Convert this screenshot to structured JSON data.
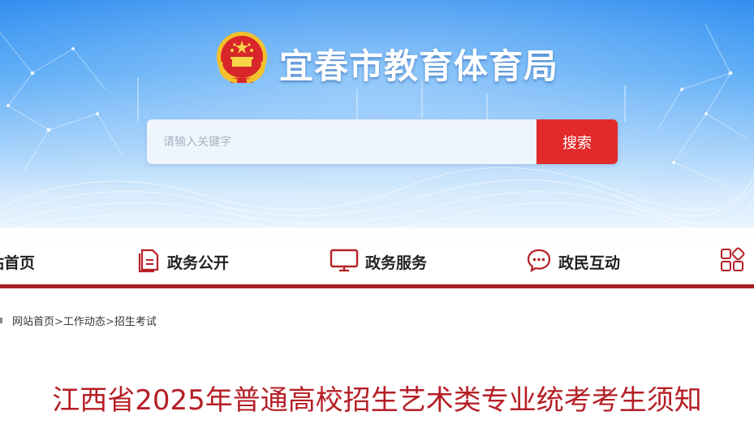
{
  "header": {
    "site_title": "宜春市教育体育局",
    "emblem": "national-emblem"
  },
  "search": {
    "placeholder": "请输入关键字",
    "value": "",
    "button_label": "搜索"
  },
  "nav": {
    "items": [
      {
        "label": "站首页",
        "icon": "home-icon"
      },
      {
        "label": "政务公开",
        "icon": "document-icon"
      },
      {
        "label": "政务服务",
        "icon": "monitor-icon"
      },
      {
        "label": "政民互动",
        "icon": "chat-icon"
      },
      {
        "label": "",
        "icon": "grid-icon"
      }
    ]
  },
  "breadcrumb": {
    "items": [
      "网站首页",
      "工作动态",
      "招生考试"
    ],
    "separator": ">"
  },
  "article": {
    "title": "江西省2025年普通高校招生艺术类专业统考考生须知"
  },
  "colors": {
    "accent_red": "#a81f24",
    "button_red": "#e32a2a",
    "title_red": "#b51f26",
    "banner_blue": "#2f8df0"
  }
}
